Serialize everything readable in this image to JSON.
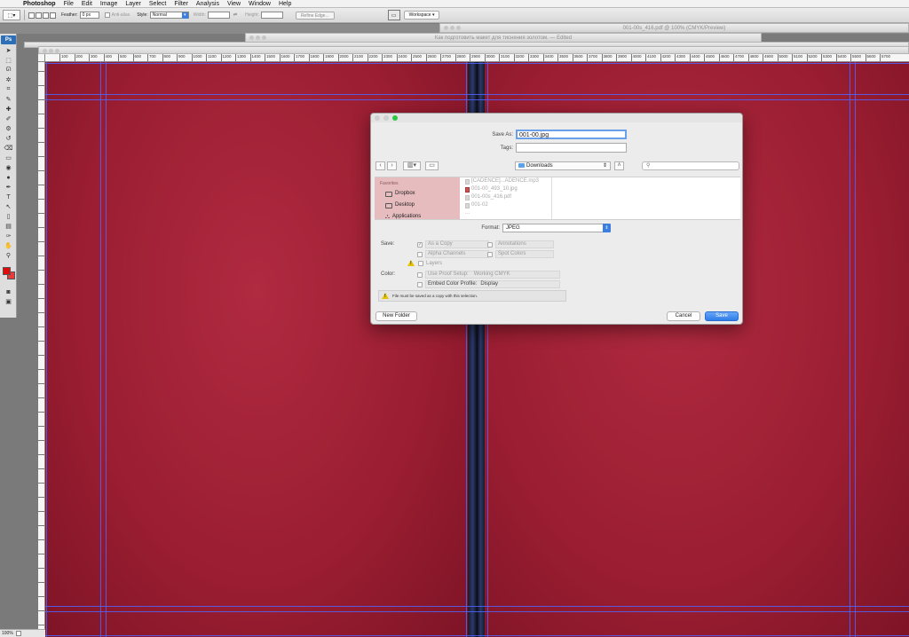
{
  "menubar": {
    "app_name": "Photoshop",
    "items": [
      "File",
      "Edit",
      "Image",
      "Layer",
      "Select",
      "Filter",
      "Analysis",
      "View",
      "Window",
      "Help"
    ]
  },
  "options_bar": {
    "feather_label": "Feather:",
    "feather_value": "0 px",
    "antialias_label": "Anti-alias",
    "style_label": "Style:",
    "style_value": "Normal",
    "width_label": "Width:",
    "height_label": "Height:",
    "refine_edge_label": "Refine Edge...",
    "workspace_label": "Workspace"
  },
  "tools": {
    "logo": "Ps",
    "icons": [
      "move-icon",
      "marquee-icon",
      "lasso-icon",
      "magic-wand-icon",
      "crop-icon",
      "eyedropper-icon",
      "healing-icon",
      "brush-icon",
      "stamp-icon",
      "history-brush-icon",
      "eraser-icon",
      "gradient-icon",
      "blur-icon",
      "dodge-icon",
      "pen-icon",
      "type-icon",
      "path-select-icon",
      "shape-icon",
      "notes-icon",
      "eyedropper2-icon",
      "hand-icon",
      "zoom-icon"
    ],
    "glyphs": [
      "➤",
      "⬚",
      "ᘏ",
      "✲",
      "⌗",
      "✎",
      "✚",
      "✐",
      "⚙",
      "↺",
      "⌫",
      "▭",
      "◉",
      "●",
      "✒",
      "T",
      "↖",
      "▯",
      "▤",
      "✑",
      "✋",
      "⚲"
    ],
    "foreground_color": "#e20b0b",
    "background_color": "#e83c3c"
  },
  "windows": {
    "doc1_title": "001-00s_416.pdf @ 100% (CMYK/Preview)",
    "doc2_title": "Как подготовить макет для тиснения золотом. — Edited"
  },
  "ruler": {
    "ticks": [
      "100",
      "200",
      "300",
      "400",
      "500",
      "600",
      "700",
      "800",
      "900",
      "1000",
      "1100",
      "1200",
      "1300",
      "1400",
      "1500",
      "1600",
      "1700",
      "1800",
      "1900",
      "2000",
      "2100",
      "2200",
      "2300",
      "2400",
      "2500",
      "2600",
      "2700",
      "2800",
      "2900",
      "3000",
      "3100",
      "3200",
      "3300",
      "3400",
      "3500",
      "3600",
      "3700",
      "3800",
      "3900",
      "4000",
      "4100",
      "4200",
      "4300",
      "4400",
      "4500",
      "4600",
      "4700",
      "4800",
      "4900",
      "5000",
      "5100",
      "5200",
      "5300",
      "5400",
      "5500",
      "5600",
      "5700"
    ]
  },
  "status": {
    "zoom": "100%"
  },
  "dialog": {
    "save_as_label": "Save As:",
    "save_as_value": "001-00.jpg",
    "tags_label": "Tags:",
    "tags_value": "",
    "location": "Downloads",
    "search_placeholder": "",
    "favorites_header": "Favorites",
    "sidebar_items": [
      "Dropbox",
      "Desktop",
      "Applications"
    ],
    "files": [
      "[CADENCE]...ADENCE.mp3",
      "001-00_493_10.jpg",
      "001-00s_416.pdf",
      "001-02",
      "..."
    ],
    "format_label": "Format:",
    "format_value": "JPEG",
    "save_label": "Save:",
    "as_copy": "As a Copy",
    "annotations": "Annotations",
    "alpha_channels": "Alpha Channels",
    "spot_colors": "Spot Colors",
    "layers": "Layers",
    "color_label": "Color:",
    "use_proof_setup": "Use Proof Setup:",
    "working_cmyk": "Working CMYK",
    "embed_profile": "Embed Color Profile:",
    "profile_value": "Display",
    "warning_text": "File must be saved as a copy with this selection.",
    "new_folder": "New Folder",
    "cancel": "Cancel",
    "save": "Save"
  }
}
